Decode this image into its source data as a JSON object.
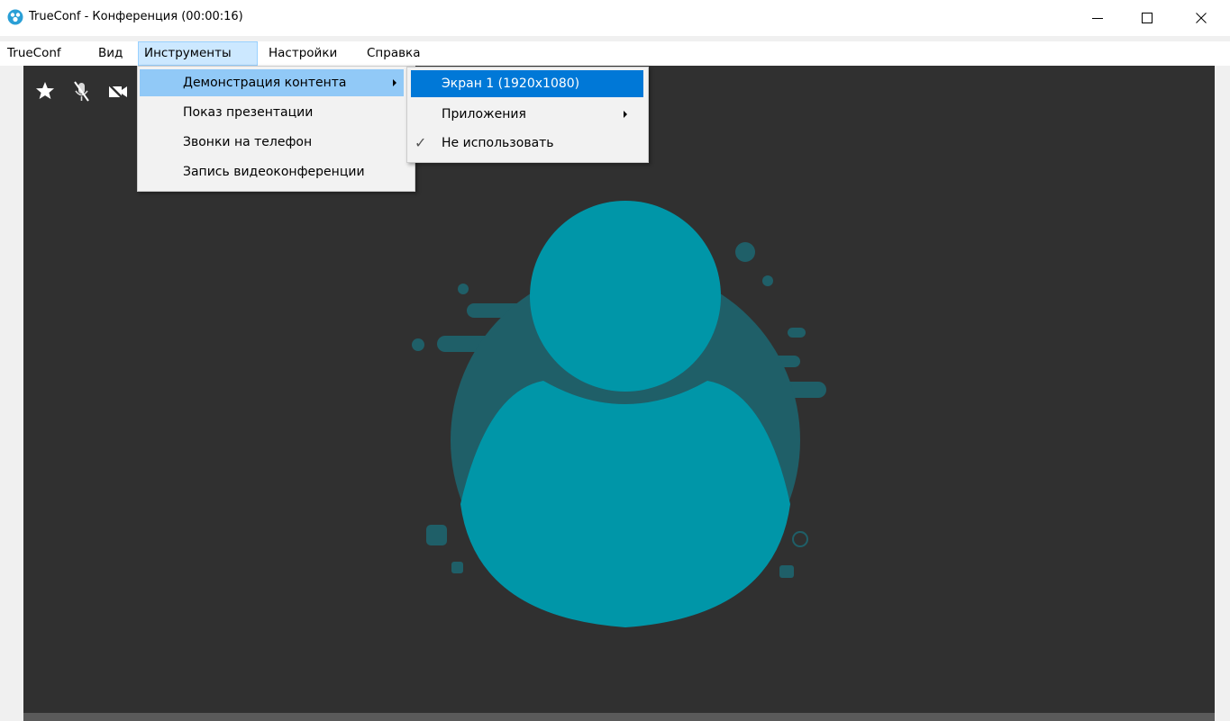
{
  "window": {
    "title": "TrueConf - Конференция (00:00:16)",
    "minimize_label": "—",
    "maximize_label": "☐",
    "close_label": "✕"
  },
  "menubar": [
    {
      "label": "TrueConf"
    },
    {
      "label": "Вид"
    },
    {
      "label": "Инструменты"
    },
    {
      "label": "Настройки"
    },
    {
      "label": "Справка"
    }
  ],
  "tools_menu": {
    "items": [
      {
        "label": "Демонстрация контента",
        "has_submenu": true
      },
      {
        "label": "Показ презентации"
      },
      {
        "label": "Звонки на телефон"
      },
      {
        "label": "Запись видеоконференции"
      }
    ]
  },
  "content_submenu": {
    "items": [
      {
        "label": "Экран 1 (1920x1080)"
      },
      {
        "label": "Приложения",
        "has_submenu": true
      },
      {
        "label": "Не использовать",
        "checked": true,
        "check_glyph": "✓"
      }
    ]
  },
  "status_icons": [
    "star-icon",
    "mic-muted-icon",
    "camera-off-icon"
  ],
  "colors": {
    "avatar_fill": "#0096a8",
    "avatar_shadow": "#1f5f68",
    "video_bg": "#303030",
    "menu_selected": "#0078d7",
    "menu_hover": "#91c9f7"
  }
}
